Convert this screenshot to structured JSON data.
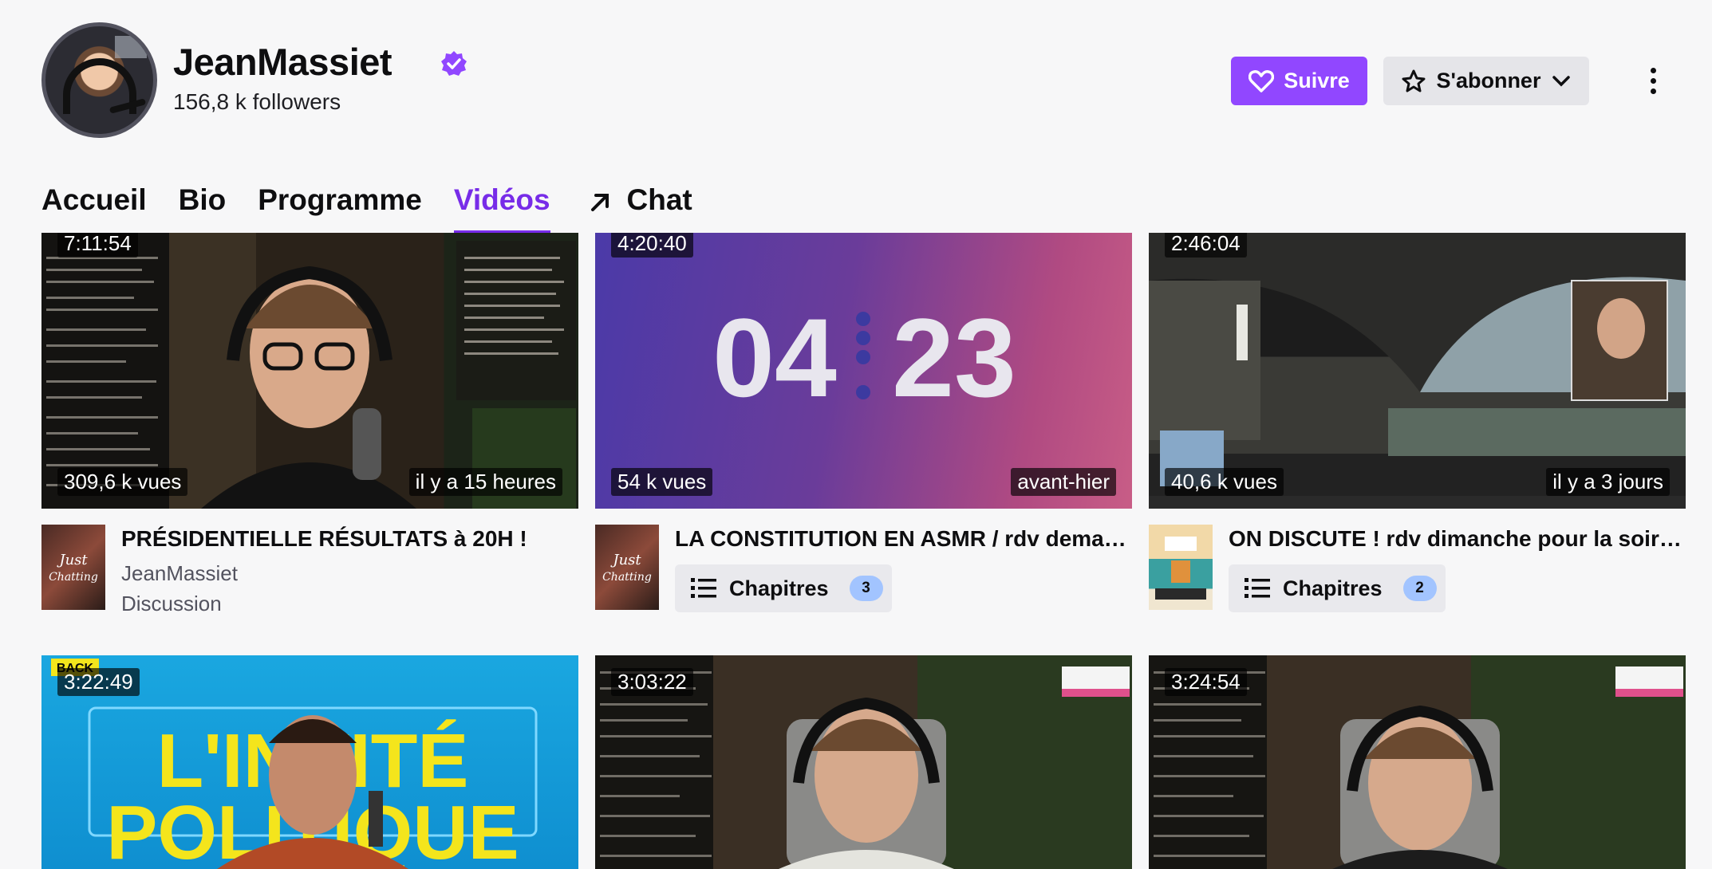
{
  "channel": {
    "name": "JeanMassiet",
    "followers": "156,8 k followers"
  },
  "actions": {
    "follow_label": "Suivre",
    "subscribe_label": "S'abonner"
  },
  "tabs": [
    {
      "label": "Accueil"
    },
    {
      "label": "Bio"
    },
    {
      "label": "Programme"
    },
    {
      "label": "Vidéos"
    },
    {
      "label": "Chat"
    }
  ],
  "videos": [
    {
      "duration": "7:11:54",
      "views": "309,6 k vues",
      "age": "il y a 15 heures",
      "title": "PRÉSIDENTIELLE RÉSULTATS à 20H !",
      "channel": "JeanMassiet",
      "category": "Discussion"
    },
    {
      "duration": "4:20:40",
      "views": "54 k vues",
      "age": "avant-hier",
      "title": "LA CONSTITUTION EN ASMR / rdv demain pour les résultats",
      "chapters_label": "Chapitres",
      "chapters_count": "3",
      "countdown_left": "04",
      "countdown_right": "23"
    },
    {
      "duration": "2:46:04",
      "views": "40,6 k vues",
      "age": "il y a 3 jours",
      "title": "ON DISCUTE ! rdv dimanche pour la soirée électorale",
      "chapters_label": "Chapitres",
      "chapters_count": "2"
    },
    {
      "duration": "3:22:49",
      "thumb_text_1": "L'INVITÉ",
      "thumb_text_2": "POLITIQUE",
      "thumb_badge": "BACK"
    },
    {
      "duration": "3:03:22"
    },
    {
      "duration": "3:24:54"
    }
  ],
  "colors": {
    "accent": "#9147ff",
    "active_tab": "#772ce8",
    "badge": "#a2c4ff"
  }
}
